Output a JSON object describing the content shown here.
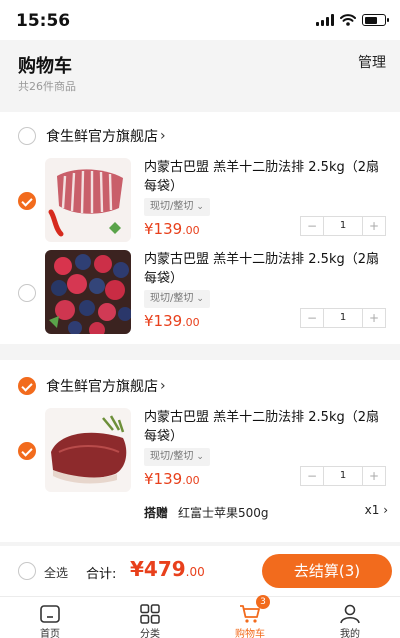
{
  "status_bar": {
    "time": "15:56"
  },
  "header": {
    "title": "购物车",
    "subtitle": "共26件商品",
    "manage_label": "管理"
  },
  "shops": [
    {
      "name": "食生鲜官方旗舰店",
      "arrow": "›",
      "selected": false,
      "products": [
        {
          "title": "内蒙古巴盟 羔羊十二肋法排 2.5kg（2扇每袋）",
          "spec": "现切/整切",
          "price_int": "¥139",
          "price_dec": ".00",
          "quantity": "1",
          "selected": true,
          "image_icon": "lamb-ribs-image"
        },
        {
          "title": "内蒙古巴盟 羔羊十二肋法排 2.5kg（2扇每袋）",
          "spec": "现切/整切",
          "price_int": "¥139",
          "price_dec": ".00",
          "quantity": "1",
          "selected": false,
          "image_icon": "berries-image"
        }
      ]
    },
    {
      "name": "食生鲜官方旗舰店",
      "arrow": "›",
      "selected": true,
      "products": [
        {
          "title": "内蒙古巴盟 羔羊十二肋法排 2.5kg（2扇每袋）",
          "spec": "现切/整切",
          "price_int": "¥139",
          "price_dec": ".00",
          "quantity": "1",
          "selected": true,
          "image_icon": "beef-image"
        }
      ],
      "gift": {
        "label": "搭赠",
        "item": "红富士苹果500g",
        "qty": "x1 ›"
      }
    }
  ],
  "stepper": {
    "minus": "−",
    "plus": "+"
  },
  "footer": {
    "select_all": "全选",
    "total_label": "合计:",
    "total_int": "¥479",
    "total_dec": ".00",
    "checkout_label": "去结算(3)"
  },
  "tab_bar": {
    "tabs": [
      {
        "label": "首页",
        "icon": "home-icon"
      },
      {
        "label": "分类",
        "icon": "category-icon"
      },
      {
        "label": "购物车",
        "icon": "cart-icon",
        "badge": "3",
        "active": true
      },
      {
        "label": "我的",
        "icon": "profile-icon"
      }
    ]
  },
  "colors": {
    "accent": "#f26b1d",
    "price": "#e8401c"
  }
}
